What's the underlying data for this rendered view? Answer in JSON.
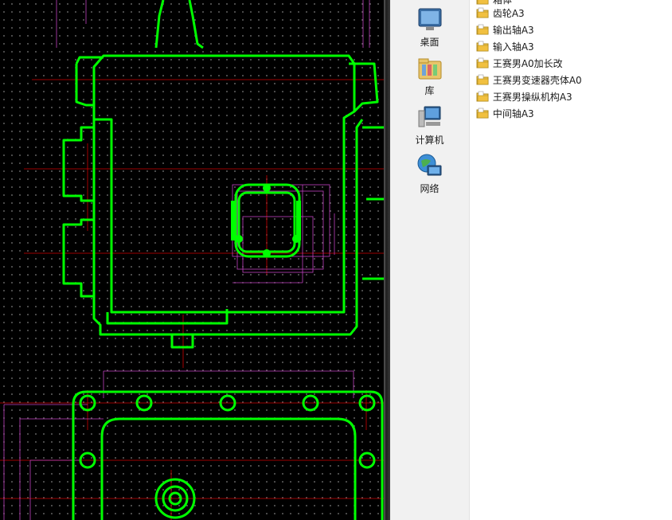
{
  "places_panel": {
    "items": [
      {
        "label": "桌面",
        "icon": "desktop-icon"
      },
      {
        "label": "库",
        "icon": "library-icon"
      },
      {
        "label": "计算机",
        "icon": "computer-icon"
      },
      {
        "label": "网络",
        "icon": "network-icon"
      }
    ]
  },
  "file_list": {
    "partial_top": "箱体",
    "items": [
      {
        "name": "齿轮A3",
        "icon": "dwg-folder-icon"
      },
      {
        "name": "输出轴A3",
        "icon": "dwg-folder-icon"
      },
      {
        "name": "输入轴A3",
        "icon": "dwg-folder-icon"
      },
      {
        "name": "王赛男A0加长改",
        "icon": "dwg-folder-icon"
      },
      {
        "name": "王赛男变速器壳体A0",
        "icon": "dwg-folder-icon"
      },
      {
        "name": "王赛男操纵机构A3",
        "icon": "dwg-folder-icon"
      },
      {
        "name": "中间轴A3",
        "icon": "dwg-folder-icon"
      }
    ]
  },
  "colors": {
    "cad_background": "#000000",
    "outline": "#00ff00",
    "centerline": "#e00000",
    "dimension": "#cc33cc",
    "panel": "#f1f1f1"
  }
}
